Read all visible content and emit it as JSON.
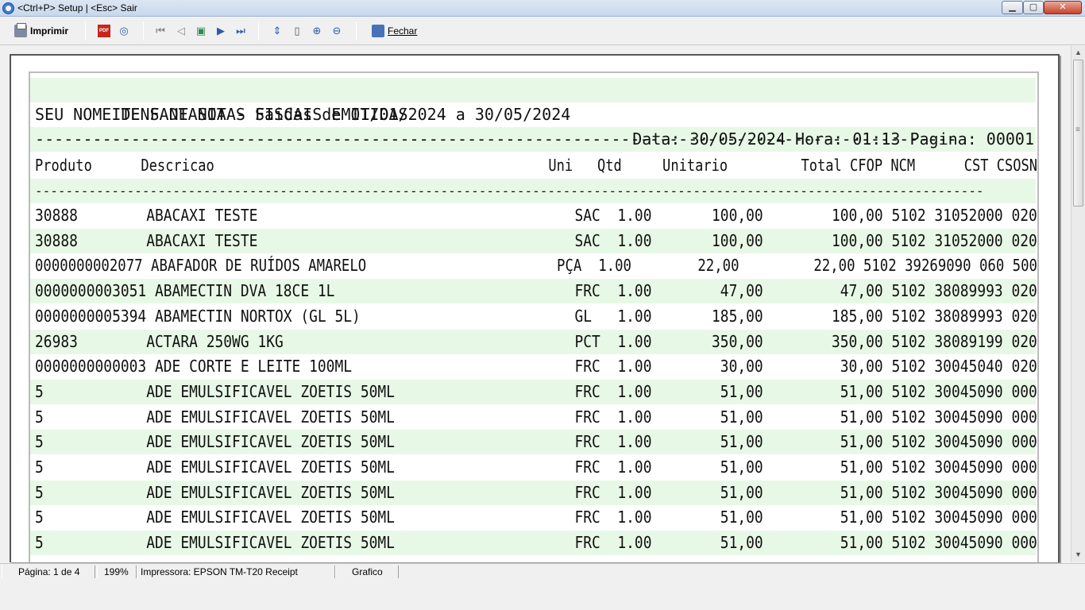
{
  "window": {
    "title": "<Ctrl+P> Setup | <Esc> Sair",
    "min_glyph": "▁",
    "max_glyph": "▢",
    "close_glyph": "✕"
  },
  "toolbar": {
    "print_label": "Imprimir",
    "pdf_text": "PDF",
    "close_label": "Fechar",
    "icons": [
      "printer-icon",
      "pdf-icon",
      "binoculars-icon",
      "first-page-icon",
      "prev-page-icon",
      "goto-page-icon",
      "next-page-icon",
      "last-page-icon",
      "page-width-icon",
      "whole-page-icon",
      "zoom-in-icon",
      "zoom-out-icon",
      "exit-icon"
    ]
  },
  "report": {
    "title": "ITENS DE NOTAS FISCAIS EMITIDAS",
    "header_right": "Data: 30/05/2024 Hora: 01:13 Pagina: 00001",
    "subtitle": "SEU NOME DE FANTASIA - Saidas de 01/01/2024 a 30/05/2024",
    "separator1": "------------------------------------------------------------------------------------------------",
    "column_header": "Produto      Descricao                                         Uni   Qtd     Unitario         Total CFOP NCM      CST CSOSN",
    "separator2": "----------------------------------------------------------------------------------------------------------------------------",
    "rows": [
      "30888        ABACAXI TESTE                                     SAC  1.00       100,00        100,00 5102 31052000 020",
      "30888        ABACAXI TESTE                                     SAC  1.00       100,00        100,00 5102 31052000 020",
      "0000000002077 ABAFADOR DE RUÍDOS AMARELO                       PÇA  1.00        22,00         22,00 5102 39269090 060 500",
      "0000000003051 ABAMECTIN DVA 18CE 1L                            FRC  1.00        47,00         47,00 5102 38089993 020",
      "0000000005394 ABAMECTIN NORTOX (GL 5L)                         GL   1.00       185,00        185,00 5102 38089993 020",
      "26983        ACTARA 250WG 1KG                                  PCT  1.00       350,00        350,00 5102 38089199 020",
      "0000000000003 ADE CORTE E LEITE 100ML                          FRC  1.00        30,00         30,00 5102 30045040 020",
      "5            ADE EMULSIFICAVEL ZOETIS 50ML                     FRC  1.00        51,00         51,00 5102 30045090 000",
      "5            ADE EMULSIFICAVEL ZOETIS 50ML                     FRC  1.00        51,00         51,00 5102 30045090 000",
      "5            ADE EMULSIFICAVEL ZOETIS 50ML                     FRC  1.00        51,00         51,00 5102 30045090 000",
      "5            ADE EMULSIFICAVEL ZOETIS 50ML                     FRC  1.00        51,00         51,00 5102 30045090 000",
      "5            ADE EMULSIFICAVEL ZOETIS 50ML                     FRC  1.00        51,00         51,00 5102 30045090 000",
      "5            ADE EMULSIFICAVEL ZOETIS 50ML                     FRC  1.00        51,00         51,00 5102 30045090 000",
      "5            ADE EMULSIFICAVEL ZOETIS 50ML                     FRC  1.00        51,00         51,00 5102 30045090 000"
    ]
  },
  "status": {
    "page": "Página: 1 de 4",
    "zoom": "199%",
    "printer": "Impressora: EPSON TM-T20 Receipt",
    "mode": "Grafico"
  },
  "scrollbar": {
    "up": "▲",
    "down": "▼"
  }
}
